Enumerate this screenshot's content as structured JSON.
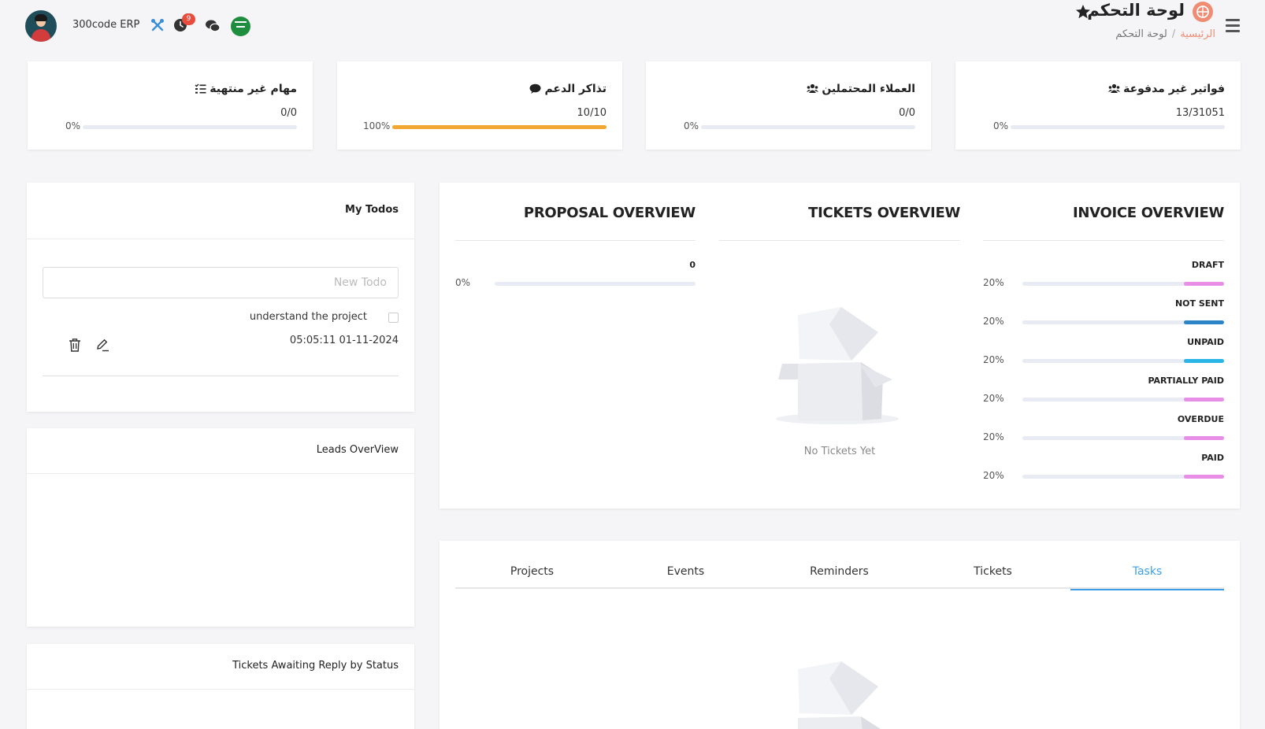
{
  "header": {
    "brand": "300code ERP",
    "notification_count": "9",
    "page_title": "لوحة التحكم",
    "breadcrumb": {
      "home": "الرئيسية",
      "separator": "/",
      "current": "لوحة التحكم"
    },
    "icons": [
      "avatar",
      "tools-icon",
      "clock-icon",
      "chat-icon",
      "saudi-flag-icon",
      "star-icon",
      "app-logo-icon",
      "menu-icon"
    ]
  },
  "stats": [
    {
      "title": "فواتير غير مدفوعة",
      "count": "13/31051",
      "percent_label": "0%",
      "percent": 0,
      "icon": "users-icon"
    },
    {
      "title": "العملاء المحتملين",
      "count": "0/0",
      "percent_label": "0%",
      "percent": 0,
      "icon": "users-icon"
    },
    {
      "title": "تذاكر الدعم",
      "count": "10/10",
      "percent_label": "100%",
      "percent": 100,
      "icon": "comment-icon"
    },
    {
      "title": "مهام غير منتهية",
      "count": "0/0",
      "percent_label": "0%",
      "percent": 0,
      "icon": "tasks-icon"
    }
  ],
  "overview": {
    "invoice": {
      "title": "INVOICE OVERVIEW",
      "items": [
        {
          "label": "DRAFT",
          "percent_label": "20%",
          "percent": 20,
          "color": "#e98ee6"
        },
        {
          "label": "NOT SENT",
          "percent_label": "20%",
          "percent": 20,
          "color": "#2b84c6"
        },
        {
          "label": "UNPAID",
          "percent_label": "20%",
          "percent": 20,
          "color": "#29b6e6"
        },
        {
          "label": "PARTIALLY PAID",
          "percent_label": "20%",
          "percent": 20,
          "color": "#e98ee6"
        },
        {
          "label": "OVERDUE",
          "percent_label": "20%",
          "percent": 20,
          "color": "#e98ee6"
        },
        {
          "label": "PAID",
          "percent_label": "20%",
          "percent": 20,
          "color": "#e98ee6"
        }
      ]
    },
    "tickets": {
      "title": "TICKETS OVERVIEW",
      "empty_text": "No Tickets Yet"
    },
    "proposal": {
      "title": "PROPOSAL OVERVIEW",
      "items": [
        {
          "label": "0",
          "percent_label": "0%",
          "percent": 0
        }
      ]
    }
  },
  "todos": {
    "title": "My Todos",
    "input_placeholder": "New Todo",
    "items": [
      {
        "text": "understand the project",
        "date": "05:05:11 01-11-2024",
        "done": false
      }
    ]
  },
  "leads": {
    "title": "Leads OverView"
  },
  "tickets_awaiting": {
    "title": "Tickets Awaiting Reply by Status"
  },
  "tabs": {
    "items": [
      "Projects",
      "Events",
      "Reminders",
      "Tickets",
      "Tasks"
    ],
    "active": "Tasks"
  }
}
